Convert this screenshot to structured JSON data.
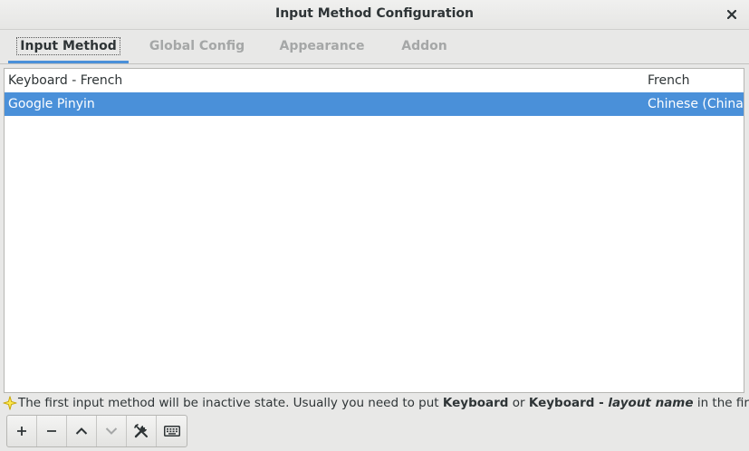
{
  "window": {
    "title": "Input Method Configuration"
  },
  "tabs": [
    {
      "label": "Input Method",
      "active": true
    },
    {
      "label": "Global Config",
      "active": false
    },
    {
      "label": "Appearance",
      "active": false
    },
    {
      "label": "Addon",
      "active": false
    }
  ],
  "input_methods": [
    {
      "name": "Keyboard - French",
      "language": "French",
      "selected": false
    },
    {
      "name": "Google Pinyin",
      "language": "Chinese (China)",
      "selected": true
    }
  ],
  "hint": {
    "prefix": "The first input method will be inactive state. Usually you need to put ",
    "bold1": "Keyboard",
    "middle": " or ",
    "bold2": "Keyboard - ",
    "bold_italic": "layout name",
    "suffix": " in the first place."
  },
  "toolbar": {
    "buttons": [
      {
        "icon": "add-icon"
      },
      {
        "icon": "remove-icon"
      },
      {
        "icon": "move-up-icon"
      },
      {
        "icon": "move-down-icon",
        "disabled": true
      },
      {
        "icon": "configure-icon"
      },
      {
        "icon": "keyboard-layout-icon"
      }
    ]
  },
  "colors": {
    "accent": "#4a90d9",
    "selected_text": "#ffffff",
    "inactive_tab": "#a5a7a7"
  }
}
